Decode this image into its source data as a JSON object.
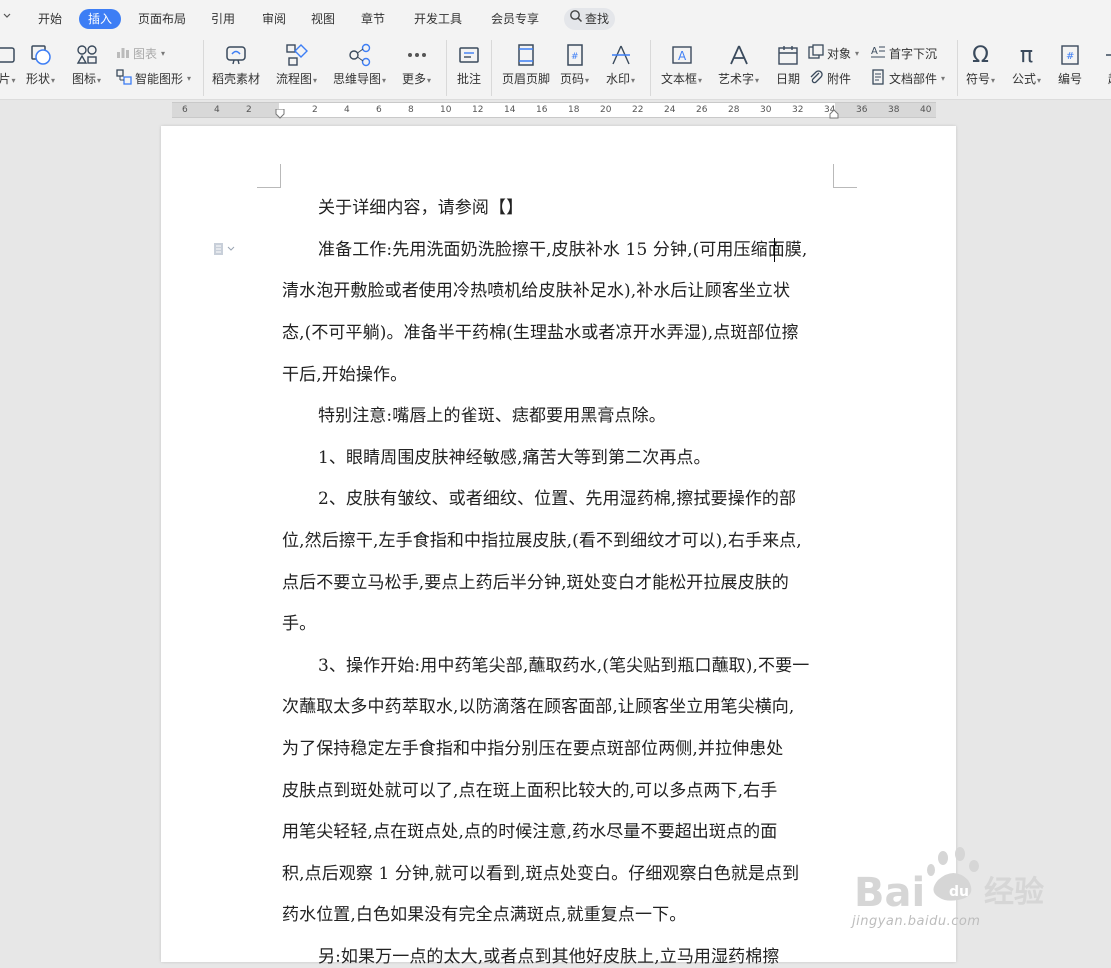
{
  "menu": {
    "tabs": [
      "开始",
      "插入",
      "页面布局",
      "引用",
      "审阅",
      "视图",
      "章节",
      "开发工具",
      "会员专享"
    ],
    "active_tab": "插入",
    "search_label": "查找"
  },
  "ribbon": {
    "partial_left": "片",
    "shape": "形状",
    "icon": "图标",
    "chart": "图表",
    "smart_art": "智能图形",
    "materials": "稻壳素材",
    "flowchart": "流程图",
    "mindmap": "思维导图",
    "more": "更多",
    "comment": "批注",
    "header_footer": "页眉页脚",
    "page_number": "页码",
    "watermark": "水印",
    "textbox": "文本框",
    "wordart": "艺术字",
    "date": "日期",
    "object": "对象",
    "attachment": "附件",
    "dropcap": "首字下沉",
    "doc_parts": "文档部件",
    "symbol": "符号",
    "formula": "公式",
    "numbering": "编号",
    "partial_right": "超"
  },
  "ruler": {
    "labels": [
      "6",
      "4",
      "2",
      "2",
      "4",
      "6",
      "8",
      "10",
      "12",
      "14",
      "16",
      "18",
      "20",
      "22",
      "24",
      "26",
      "28",
      "30",
      "32",
      "34",
      "36",
      "38",
      "40"
    ]
  },
  "document": {
    "lines": [
      "关于详细内容，请参阅【】",
      "准备工作:先用洗面奶洗脸擦干,皮肤补水 15 分钟,(可用压缩面膜,",
      "清水泡开敷脸或者使用冷热喷机给皮肤补足水),补水后让顾客坐立状",
      "态,(不可平躺)。准备半干药棉(生理盐水或者凉开水弄湿),点斑部位擦",
      "干后,开始操作。",
      "特别注意:嘴唇上的雀斑、痣都要用黑膏点除。",
      "1、眼睛周围皮肤神经敏感,痛苦大等到第二次再点。",
      "2、皮肤有皱纹、或者细纹、位置、先用湿药棉,擦拭要操作的部",
      "位,然后擦干,左手食指和中指拉展皮肤,(看不到细纹才可以),右手来点,",
      "点后不要立马松手,要点上药后半分钟,斑处变白才能松开拉展皮肤的",
      "手。",
      "3、操作开始:用中药笔尖部,蘸取药水,(笔尖贴到瓶口蘸取),不要一",
      "次蘸取太多中药萃取水,以防滴落在顾客面部,让顾客坐立用笔尖横向,",
      "为了保持稳定左手食指和中指分别压在要点斑部位两侧,并拉伸患处",
      "皮肤点到斑处就可以了,点在斑上面积比较大的,可以多点两下,右手",
      "用笔尖轻轻,点在斑点处,点的时候注意,药水尽量不要超出斑点的面",
      "积,点后观察 1 分钟,就可以看到,斑点处变白。仔细观察白色就是点到",
      "药水位置,白色如果没有完全点满斑点,就重复点一下。",
      "另:如果万一点的太大,或者点到其他好皮肤上,立马用湿药棉擦"
    ]
  },
  "watermark": {
    "brand_text": "Bai",
    "brand_cn": "经验",
    "url": "jingyan.baidu.com"
  },
  "colors": {
    "accent": "#3d7ef5",
    "toolbar_bg": "#f3f3f3",
    "canvas_bg": "#e7e7e7"
  }
}
